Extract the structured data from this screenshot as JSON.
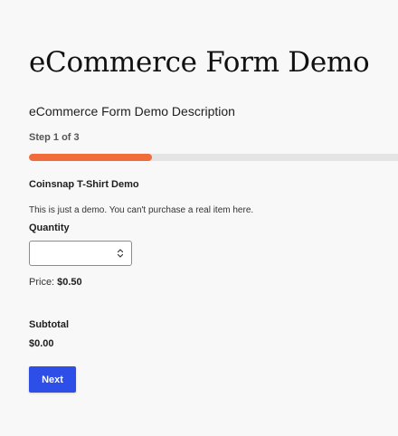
{
  "page": {
    "title": "eCommerce Form Demo",
    "description": "eCommerce Form Demo Description"
  },
  "progress": {
    "step_label": "Step 1 of 3",
    "current_step": 1,
    "total_steps": 3,
    "fraction": 0.3333,
    "fill_color": "#f06c3b",
    "track_color": "#e4e4e4"
  },
  "product": {
    "name": "Coinsnap T-Shirt Demo",
    "description": "This is just a demo. You can't purchase a real item here.",
    "quantity_label": "Quantity",
    "quantity_value": "",
    "quantity_icon": "spinner-arrows-icon",
    "price_label": "Price:",
    "price_value": "$0.50"
  },
  "summary": {
    "subtotal_label": "Subtotal",
    "subtotal_value": "$0.00"
  },
  "actions": {
    "next_label": "Next",
    "next_color": "#2e4ee8"
  }
}
